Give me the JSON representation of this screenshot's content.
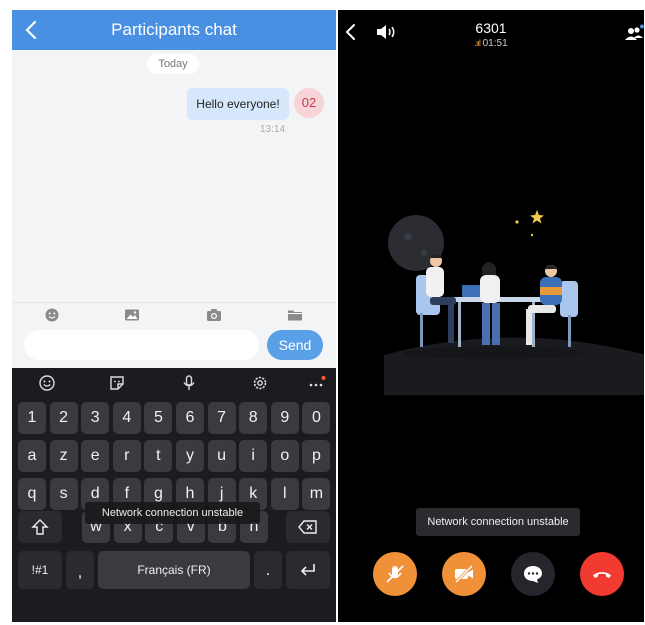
{
  "chat": {
    "title": "Participants chat",
    "date_label": "Today",
    "message": {
      "text": "Hello everyone!",
      "sender": "02",
      "time": "13:14"
    },
    "input_placeholder": "",
    "send_label": "Send",
    "toolbar_icons": [
      "emoji-icon",
      "image-icon",
      "camera-icon",
      "folder-icon"
    ]
  },
  "keyboard": {
    "top_icons": [
      "emoji-icon",
      "sticker-icon",
      "microphone-icon",
      "settings-icon",
      "more-icon"
    ],
    "row_numbers": [
      "1",
      "2",
      "3",
      "4",
      "5",
      "6",
      "7",
      "8",
      "9",
      "0"
    ],
    "row_a": [
      "a",
      "z",
      "e",
      "r",
      "t",
      "y",
      "u",
      "i",
      "o",
      "p"
    ],
    "row_q": [
      "q",
      "s",
      "d",
      "f",
      "g",
      "h",
      "j",
      "k",
      "l",
      "m"
    ],
    "row_w": [
      "w",
      "x",
      "c",
      "v",
      "b",
      "n"
    ],
    "symbols_key": "!#1",
    "comma_key": ",",
    "space_label": "Français (FR)",
    "period_key": "."
  },
  "toast_text": "Network connection unstable",
  "call": {
    "number": "6301",
    "duration": "01:51"
  },
  "colors": {
    "header_blue": "#4a90e2",
    "send_blue": "#5aa0e8",
    "orange_button": "#f0913a",
    "hangup_red": "#f23b30",
    "signal": "#e8953a"
  }
}
